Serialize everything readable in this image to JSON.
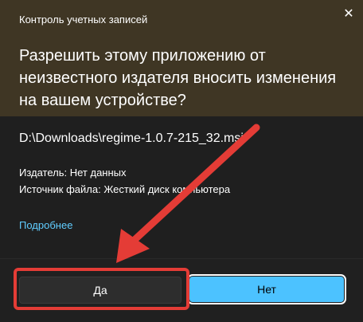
{
  "dialog": {
    "window_title": "Контроль учетных записей",
    "close_icon": "close-icon",
    "question": "Разрешить этому приложению от неизвестного издателя вносить изменения на вашем устройстве?",
    "file_path": "D:\\Downloads\\regime-1.0.7-215_32.msi",
    "publisher": "Издатель: Нет данных",
    "source": "Источник файла: Жесткий диск компьютера",
    "details_link": "Подробнее"
  },
  "buttons": {
    "yes": "Да",
    "no": "Нет"
  },
  "colors": {
    "header_bg": "#3f3624",
    "body_bg": "#1f1f1f",
    "link": "#60cdff",
    "primary_button": "#4cc2ff",
    "annotation": "#e43c36"
  }
}
